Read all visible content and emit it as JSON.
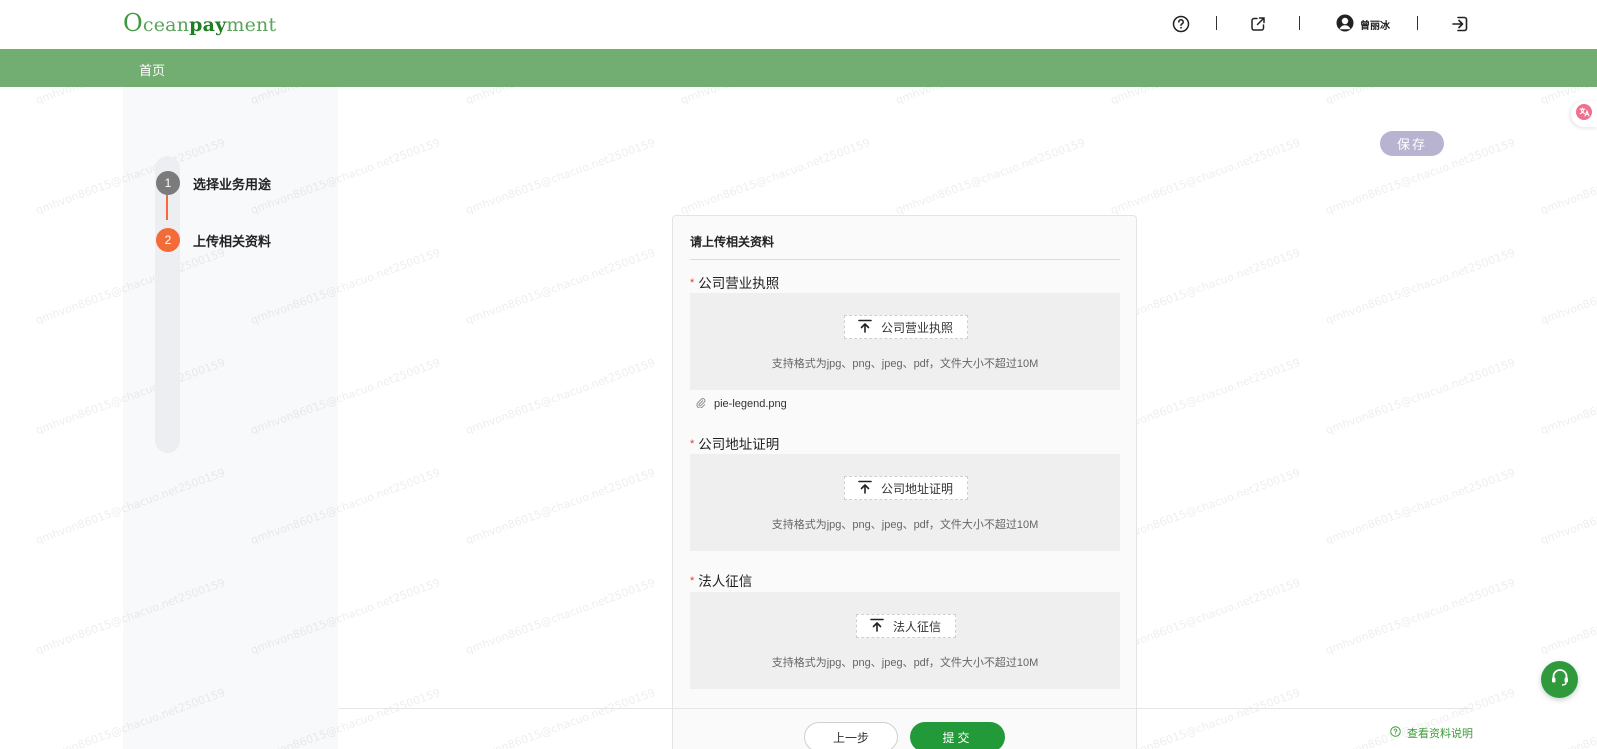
{
  "header": {
    "logo": {
      "o": "O",
      "ocean": "cean",
      "pay": "pay",
      "ment": "ment"
    },
    "user_name": "曾丽冰",
    "icons": [
      "help-icon",
      "external-link-icon",
      "avatar-icon",
      "logout-icon"
    ]
  },
  "nav": {
    "home": "首页"
  },
  "steps": [
    {
      "num": "1",
      "label": "选择业务用途",
      "state": "done",
      "color": "#7b7b7b"
    },
    {
      "num": "2",
      "label": "上传相关资料",
      "state": "active",
      "color": "#f26b38"
    }
  ],
  "save_label": "保存",
  "card": {
    "title": "请上传相关资料",
    "fields": [
      {
        "label": "公司营业执照",
        "required": "*",
        "upload_label": "公司营业执照",
        "hint": "支持格式为jpg、png、jpeg、pdf，文件大小不超过10M",
        "file": "pie-legend.png"
      },
      {
        "label": "公司地址证明",
        "required": "*",
        "upload_label": "公司地址证明",
        "hint": "支持格式为jpg、png、jpeg、pdf，文件大小不超过10M"
      },
      {
        "label": "法人征信",
        "required": "*",
        "upload_label": "法人征信",
        "hint": "支持格式为jpg、png、jpeg、pdf，文件大小不超过10M"
      }
    ]
  },
  "footer": {
    "prev": "上一步",
    "submit": "提交",
    "help": "查看资料说明"
  },
  "watermark": "qmhvon86015@chacuo.net2500159",
  "colors": {
    "brand_green": "#229a3a",
    "nav_green": "#72ad72",
    "step_active": "#f26b38",
    "save_btn": "#b7b3d0"
  }
}
